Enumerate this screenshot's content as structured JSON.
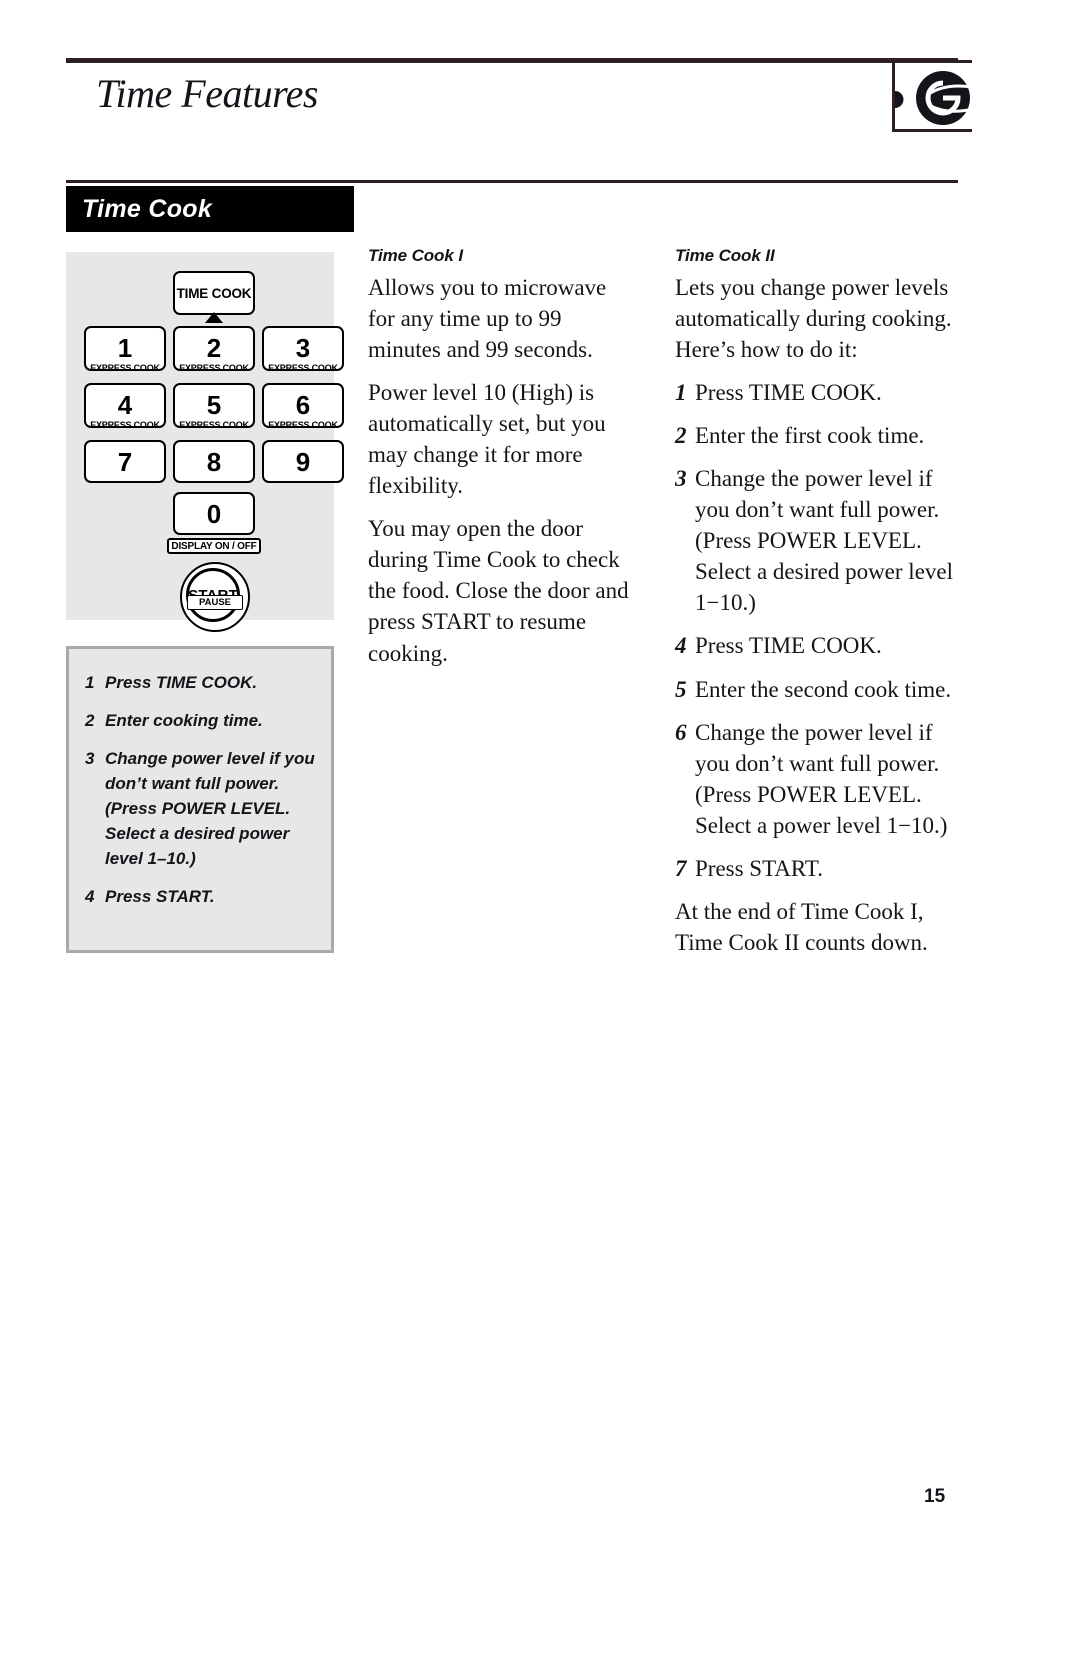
{
  "header": {
    "title": "Time Features",
    "logo_name": "ge-logo"
  },
  "section": {
    "band_label": "Time Cook"
  },
  "keypad": {
    "time_cook_key": "TIME COOK",
    "keys": [
      {
        "digit": "1",
        "sub": "EXPRESS COOK"
      },
      {
        "digit": "2",
        "sub": "EXPRESS COOK"
      },
      {
        "digit": "3",
        "sub": "EXPRESS COOK"
      },
      {
        "digit": "4",
        "sub": "EXPRESS COOK"
      },
      {
        "digit": "5",
        "sub": "EXPRESS COOK"
      },
      {
        "digit": "6",
        "sub": "EXPRESS COOK"
      },
      {
        "digit": "7",
        "sub": ""
      },
      {
        "digit": "8",
        "sub": ""
      },
      {
        "digit": "9",
        "sub": ""
      },
      {
        "digit": "0",
        "sub": ""
      }
    ],
    "display_on_off": "DISPLAY ON / OFF",
    "start_label": "START",
    "pause_label": "PAUSE"
  },
  "steps_box": {
    "steps": [
      {
        "num": "1",
        "text": "Press TIME COOK."
      },
      {
        "num": "2",
        "text": "Enter cooking time."
      },
      {
        "num": "3",
        "text": "Change power level if you don’t want full power. (Press POWER LEVEL. Select a desired power level 1–10.)"
      },
      {
        "num": "4",
        "text": "Press START."
      }
    ]
  },
  "time_cook_i": {
    "heading": "Time Cook I",
    "paragraphs": [
      "Allows you to microwave for any time up to 99 minutes and 99 seconds.",
      "Power level 10 (High) is automatically set, but you may change it for more flexibility.",
      "You may open the door during Time Cook to check the food. Close the door and press START to resume cooking."
    ]
  },
  "time_cook_ii": {
    "heading": "Time Cook II",
    "intro": "Lets you change power levels automatically during cooking. Here’s how to do it:",
    "steps": [
      {
        "num": "1",
        "text": "Press TIME COOK."
      },
      {
        "num": "2",
        "text": "Enter the first cook time."
      },
      {
        "num": "3",
        "text": "Change the power level if you don’t want full power. (Press POWER LEVEL. Select a desired power level 1−10.)"
      },
      {
        "num": "4",
        "text": "Press TIME COOK."
      },
      {
        "num": "5",
        "text": "Enter the second cook time."
      },
      {
        "num": "6",
        "text": "Change the power level if you don’t want full power. (Press POWER LEVEL. Select a power level 1−10.)"
      },
      {
        "num": "7",
        "text": "Press START."
      }
    ],
    "closing": "At the end of Time Cook I, Time Cook II counts down."
  },
  "footer": {
    "page_number": "15"
  }
}
